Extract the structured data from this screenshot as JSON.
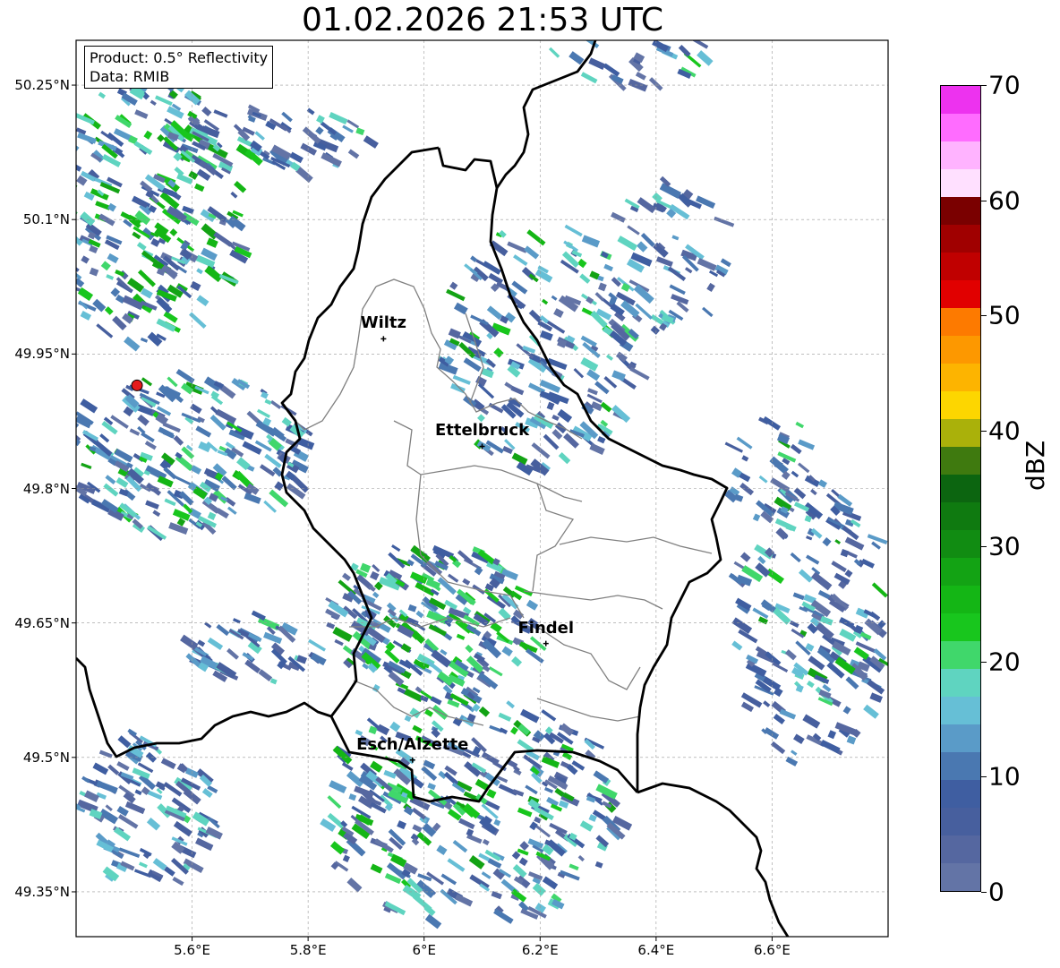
{
  "title": "01.02.2026 21:53 UTC",
  "info": {
    "product": "Product: 0.5° Reflectivity",
    "data": "Data: RMIB"
  },
  "axes": {
    "lat_labels": [
      "50.25°N",
      "50.1°N",
      "49.95°N",
      "49.8°N",
      "49.65°N",
      "49.5°N",
      "49.35°N"
    ],
    "lat_values": [
      50.25,
      50.1,
      49.95,
      49.8,
      49.65,
      49.5,
      49.35
    ],
    "lon_labels": [
      "5.6°E",
      "5.8°E",
      "6°E",
      "6.2°E",
      "6.4°E",
      "6.6°E"
    ],
    "lon_values": [
      5.6,
      5.8,
      6.0,
      6.2,
      6.4,
      6.6
    ],
    "lon_range": [
      5.4,
      6.8
    ],
    "lat_range": [
      49.3,
      50.3
    ]
  },
  "cities": [
    {
      "name": "Wiltz",
      "lon": 5.93,
      "lat": 49.967
    },
    {
      "name": "Ettelbruck",
      "lon": 6.1,
      "lat": 49.847
    },
    {
      "name": "Findel",
      "lon": 6.21,
      "lat": 49.627
    },
    {
      "name": "Esch/Alzette",
      "lon": 5.98,
      "lat": 49.497
    }
  ],
  "radar_site": {
    "lon": 5.505,
    "lat": 49.915,
    "color": "#e41a1c"
  },
  "colorbar": {
    "label": "dBZ",
    "ticks": [
      "0",
      "10",
      "20",
      "30",
      "40",
      "50",
      "60",
      "70"
    ],
    "colors": [
      "#6374a6",
      "#5567a0",
      "#475f9e",
      "#3f5ea1",
      "#4a78b1",
      "#5a9bc8",
      "#66bfd6",
      "#5fd4c0",
      "#40d76b",
      "#18c61d",
      "#14b615",
      "#13a314",
      "#118c12",
      "#0f7a10",
      "#0c6510",
      "#3f7a0f",
      "#aab10a",
      "#fdd600",
      "#fdb400",
      "#fd9800",
      "#fd7a00",
      "#e10000",
      "#c00000",
      "#a00000",
      "#7a0000",
      "#ffe0ff",
      "#ffb3ff",
      "#ff6cff",
      "#ed32ef"
    ]
  }
}
